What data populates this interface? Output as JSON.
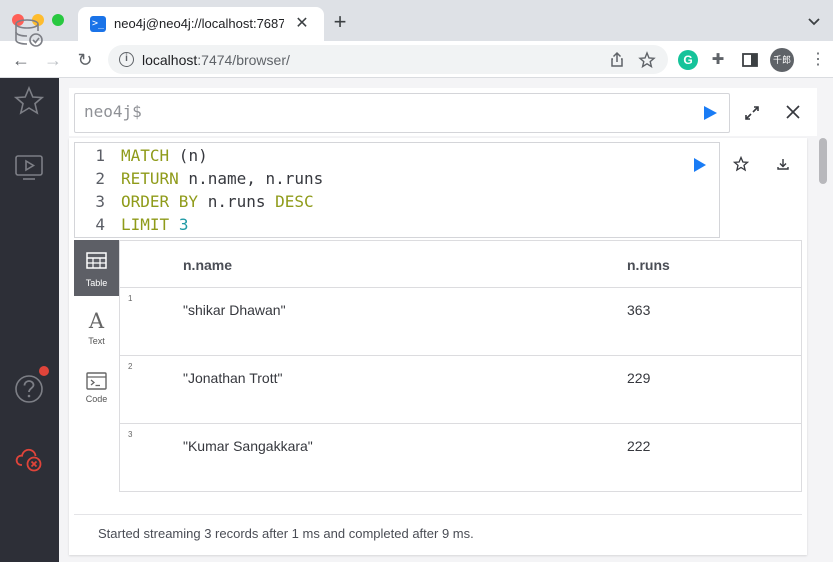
{
  "browser": {
    "tab_title": "neo4j@neo4j://localhost:7687/",
    "url_host": "localhost",
    "url_rest": ":7474/browser/",
    "profile_initials": "千郎"
  },
  "editor": {
    "prompt": "neo4j$"
  },
  "query": {
    "lines": [
      {
        "num": "1",
        "kw": "MATCH",
        "text": " (n)",
        "extra": ""
      },
      {
        "num": "2",
        "kw": "RETURN",
        "text": " n.name, n.runs",
        "extra": ""
      },
      {
        "num": "3",
        "kw": "ORDER BY",
        "text": " n.runs ",
        "extra": "DESC"
      },
      {
        "num": "4",
        "kw": "LIMIT",
        "text": " ",
        "extra": "3"
      }
    ]
  },
  "views": {
    "table": "Table",
    "text": "Text",
    "code": "Code"
  },
  "table": {
    "columns": [
      "n.name",
      "n.runs"
    ],
    "rows": [
      {
        "num": "1",
        "name": "\"shikar Dhawan\"",
        "runs": "363"
      },
      {
        "num": "2",
        "name": "\"Jonathan Trott\"",
        "runs": "229"
      },
      {
        "num": "3",
        "name": "\"Kumar Sangakkara\"",
        "runs": "222"
      }
    ]
  },
  "status": "Started streaming 3 records after 1 ms and completed after 9 ms.",
  "colors": {
    "sidebar_bg": "#2d2f37",
    "run_blue": "#1a7cf5",
    "keyword": "#8f9b1a",
    "number": "#1f9aa5"
  }
}
